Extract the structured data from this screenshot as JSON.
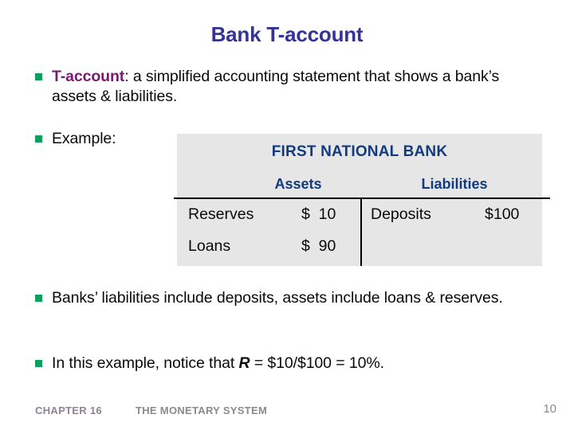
{
  "slide": {
    "title": "Bank T-account",
    "bullets": [
      {
        "keyword": "T-account",
        "text": ": a simplified accounting statement that shows a bank’s assets & liabilities."
      },
      {
        "text": "Example:"
      },
      {
        "text": "Banks’ liabilities include deposits, assets include loans & reserves."
      },
      {
        "prefix": "In this example, notice that ",
        "variable": "R",
        "suffix": " = $10/$100 = 10%."
      }
    ],
    "taccount": {
      "bank_name": "FIRST NATIONAL BANK",
      "assets_header": "Assets",
      "liabilities_header": "Liabilities",
      "assets": [
        {
          "label": "Reserves",
          "value": "$  10"
        },
        {
          "label": "Loans",
          "value": "$  90"
        }
      ],
      "liabilities": [
        {
          "label": "Deposits",
          "value": "$100"
        }
      ]
    },
    "footer": {
      "chapter": "CHAPTER 16",
      "topic": "THE MONETARY SYSTEM",
      "page": "10"
    },
    "colors": {
      "title": "#333399",
      "bullet_marker": "#0DA05C",
      "keyword": "#7A1A72",
      "table_header": "#123A80",
      "table_background": "#e6e6e6",
      "footer_chapter": "#8E8295",
      "footer_topic": "#8A8A8A"
    }
  }
}
